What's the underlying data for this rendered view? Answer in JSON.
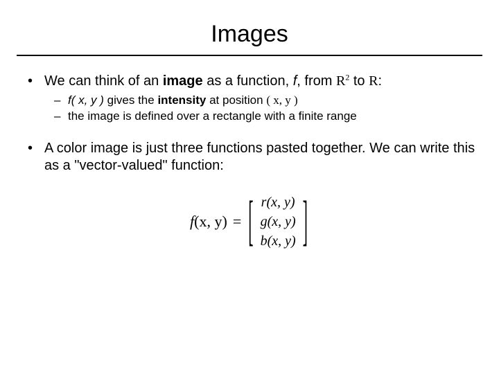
{
  "title": "Images",
  "bullets": {
    "b1": {
      "pre": "We can think of an ",
      "bold": "image",
      "mid": " as a function, ",
      "f": "f",
      "post1": ", from ",
      "R": "R",
      "sup2": "2",
      "to": " to ",
      "R2": "R",
      "colon": ":"
    },
    "sub": {
      "s1": {
        "fxy": "f( x, y )",
        "mid": " gives the ",
        "bold": "intensity",
        "post": " at position ",
        "xy": "( x, y )"
      },
      "s2": "the image is defined over a rectangle with a finite range"
    },
    "b2": "A color image is just three functions pasted together.  We can write this as a \"vector-valued\" function:"
  },
  "eqn": {
    "lhs_f": "f",
    "lhs_args": "(x, y)",
    "eq": "=",
    "rows": {
      "r": "r(x, y)",
      "g": "g(x, y)",
      "b": "b(x, y)"
    },
    "lbracket": "[",
    "rbracket": "]"
  }
}
